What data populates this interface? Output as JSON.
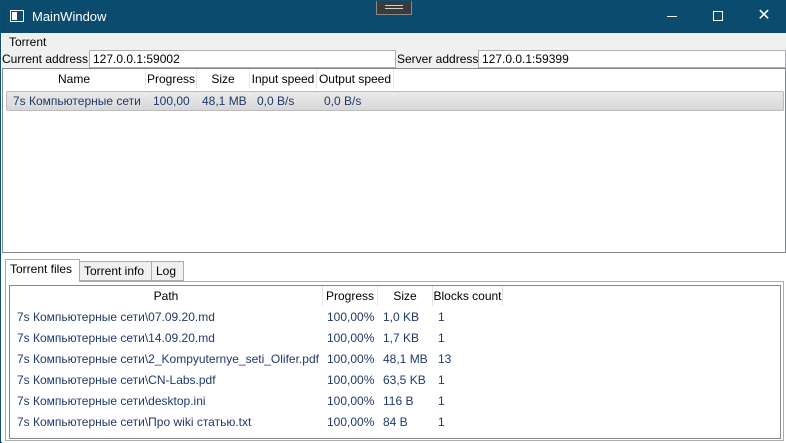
{
  "window": {
    "title": "MainWindow",
    "minimize_label": "",
    "close_label": "✕"
  },
  "menu": {
    "items": [
      "Torrent"
    ]
  },
  "addresses": {
    "current_label": "Current address:",
    "current_value": "127.0.0.1:59002",
    "server_label": "Server address:",
    "server_value": "127.0.0.1:59399"
  },
  "torrents": {
    "columns": [
      "Name",
      "Progress",
      "Size",
      "Input speed",
      "Output speed"
    ],
    "rows": [
      {
        "name": "7s Компьютерные сети",
        "progress": "100,00",
        "size": "48,1 MB",
        "input_speed": "0,0 B/s",
        "output_speed": "0,0 B/s"
      }
    ]
  },
  "tabs": [
    "Torrent files",
    "Torrent info",
    "Log"
  ],
  "files": {
    "columns": [
      "Path",
      "Progress",
      "Size",
      "Blocks count"
    ],
    "rows": [
      {
        "path": "7s Компьютерные сети\\07.09.20.md",
        "progress": "100,00%",
        "size": "1,0 KB",
        "blocks": "1"
      },
      {
        "path": "7s Компьютерные сети\\14.09.20.md",
        "progress": "100,00%",
        "size": "1,7 KB",
        "blocks": "1"
      },
      {
        "path": "7s Компьютерные сети\\2_Kompyuternye_seti_Olifer.pdf",
        "progress": "100,00%",
        "size": "48,1 MB",
        "blocks": "13"
      },
      {
        "path": "7s Компьютерные сети\\CN-Labs.pdf",
        "progress": "100,00%",
        "size": "63,5 KB",
        "blocks": "1"
      },
      {
        "path": "7s Компьютерные сети\\desktop.ini",
        "progress": "100,00%",
        "size": "116 B",
        "blocks": "1"
      },
      {
        "path": "7s Компьютерные сети\\Про wiki статью.txt",
        "progress": "100,00%",
        "size": "84 B",
        "blocks": "1"
      }
    ]
  },
  "colors": {
    "titlebar": "#0b4b6e",
    "row_text": "#1f3a6a"
  }
}
